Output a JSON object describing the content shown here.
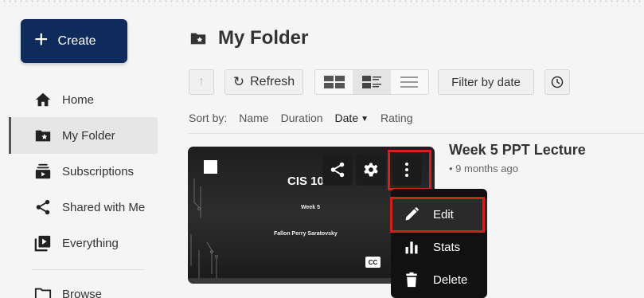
{
  "sidebar": {
    "create_label": "Create",
    "items": [
      {
        "label": "Home",
        "icon": "home-icon"
      },
      {
        "label": "My Folder",
        "icon": "folder-star-icon",
        "active": true
      },
      {
        "label": "Subscriptions",
        "icon": "subscriptions-icon"
      },
      {
        "label": "Shared with Me",
        "icon": "share-icon"
      },
      {
        "label": "Everything",
        "icon": "play-stack-icon"
      },
      {
        "label": "Browse",
        "icon": "folder-icon"
      }
    ]
  },
  "header": {
    "title": "My Folder"
  },
  "toolbar": {
    "refresh_label": "Refresh",
    "filter_label": "Filter by date",
    "views": [
      "grid-view-icon",
      "detail-view-icon",
      "list-view-icon"
    ]
  },
  "sort": {
    "label": "Sort by:",
    "options": [
      "Name",
      "Duration",
      "Date",
      "Rating"
    ],
    "active": "Date"
  },
  "video": {
    "title": "Week 5 PPT Lecture",
    "meta": "• 9 months ago",
    "slide_title": "CIS 101",
    "slide_subtitle": "Week 5",
    "slide_author": "Fallon Perry Saratovsky",
    "cc_label": "CC"
  },
  "menu": {
    "items": [
      {
        "label": "Edit",
        "icon": "pencil-icon"
      },
      {
        "label": "Stats",
        "icon": "bar-chart-icon"
      },
      {
        "label": "Delete",
        "icon": "trash-icon"
      }
    ]
  },
  "colors": {
    "primary": "#0e2b5c",
    "highlight": "#d3201c",
    "menu_bg": "#111111"
  }
}
